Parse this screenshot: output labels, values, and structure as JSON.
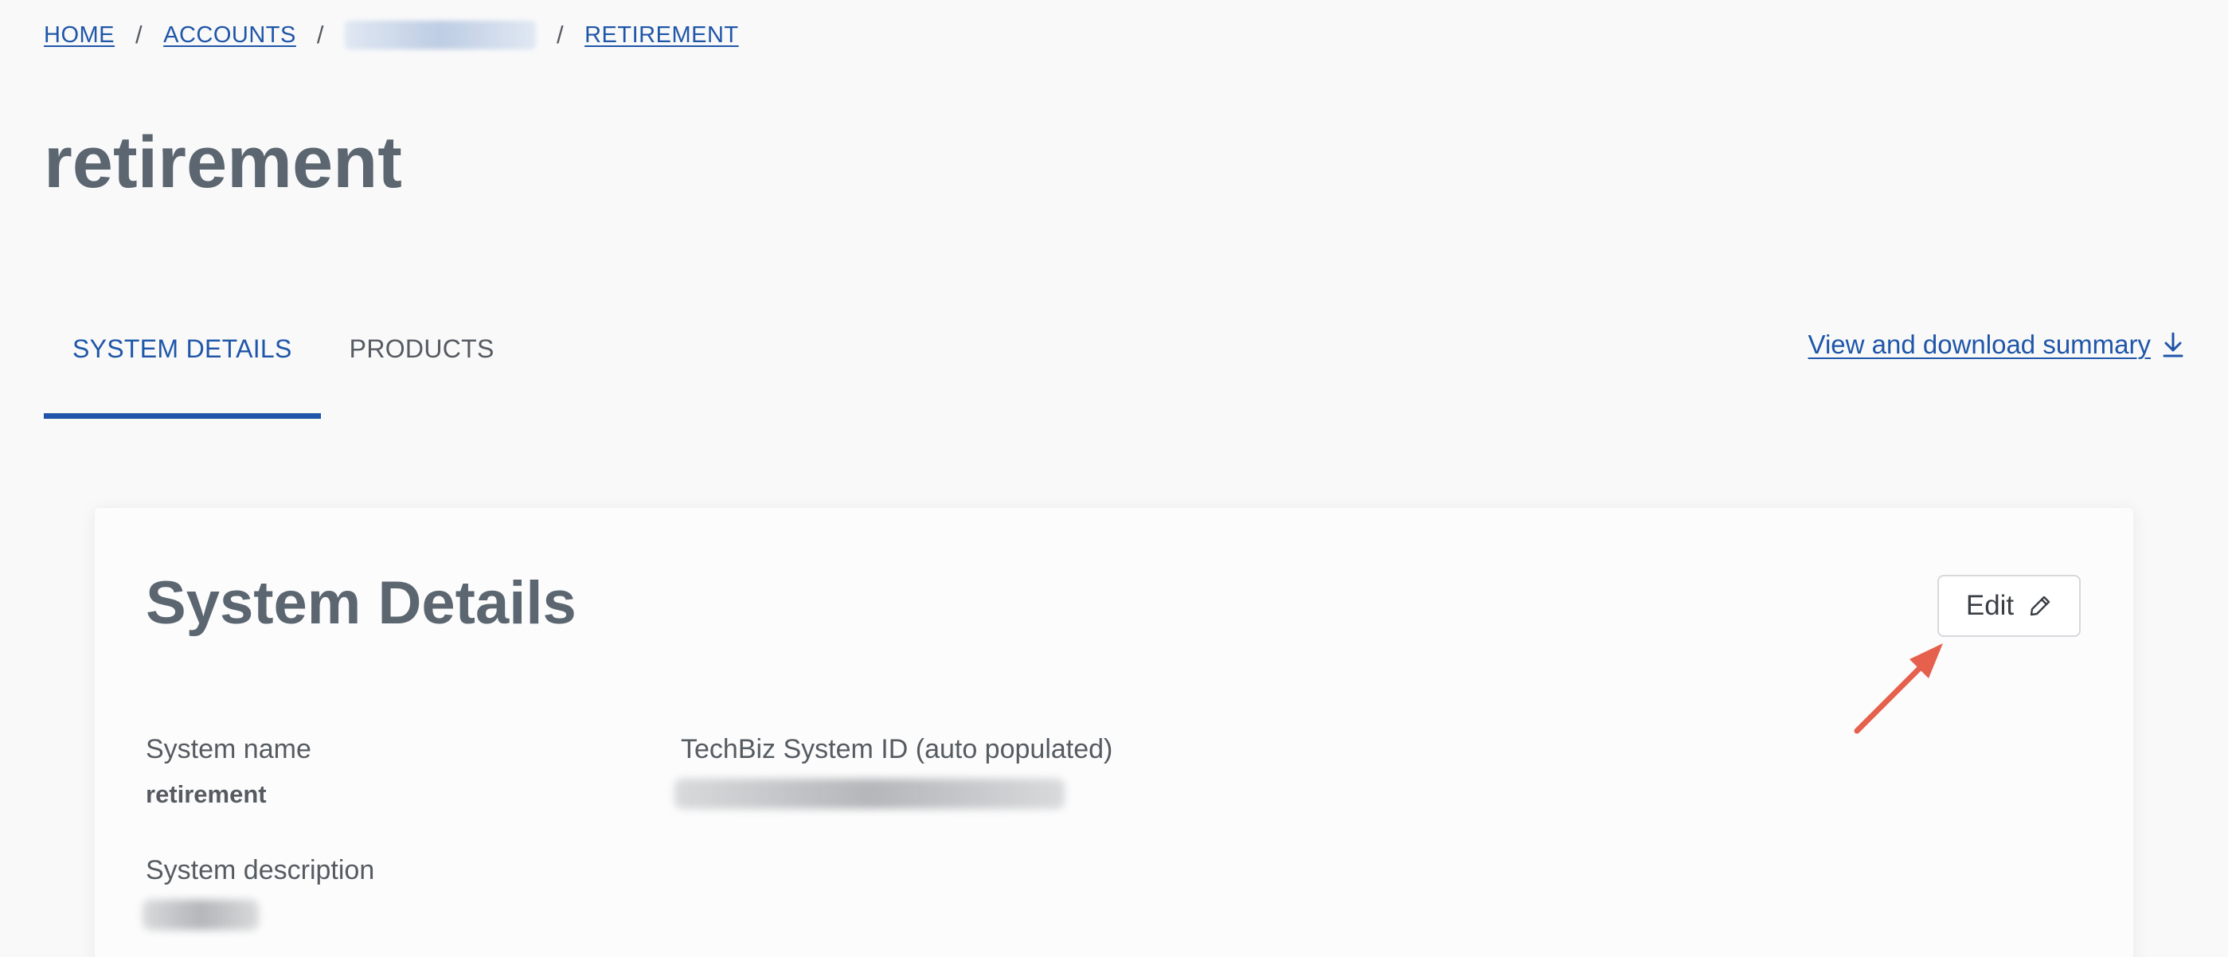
{
  "breadcrumb": {
    "home": "HOME",
    "accounts": "ACCOUNTS",
    "retirement": "RETIREMENT",
    "separator": "/"
  },
  "page_title": "retirement",
  "tabs": [
    {
      "label": "SYSTEM DETAILS",
      "active": true
    },
    {
      "label": "PRODUCTS",
      "active": false
    }
  ],
  "summary_link": {
    "label": "View and download summary",
    "icon": "download-icon"
  },
  "card": {
    "title": "System Details",
    "edit_label": "Edit",
    "edit_icon": "pencil-icon",
    "fields": {
      "system_name_label": "System name",
      "system_name_value": "retirement",
      "techbiz_id_label": "TechBiz System ID (auto populated)",
      "description_label": "System description"
    }
  },
  "colors": {
    "link": "#1f56a8",
    "title": "#5b6670",
    "text": "#555b61",
    "annotation_arrow": "#e5604d",
    "background": "#f9f9fa"
  }
}
